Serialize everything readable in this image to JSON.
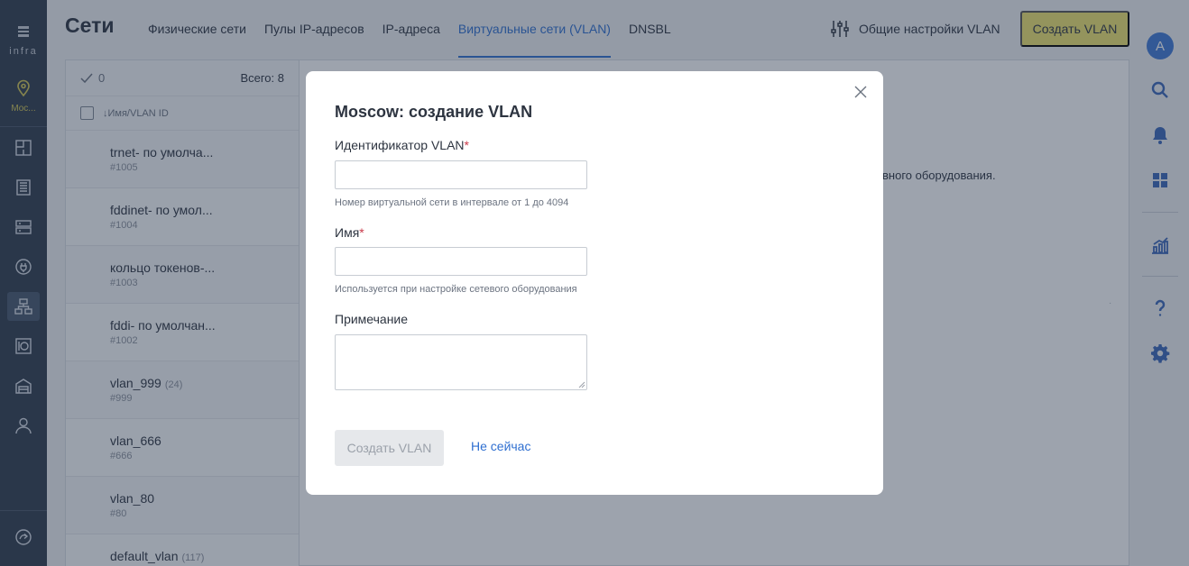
{
  "app": {
    "logo": "infra",
    "location": "Moc..."
  },
  "header": {
    "title": "Сети",
    "tabs": [
      {
        "label": "Физические сети"
      },
      {
        "label": "Пулы IP-адресов"
      },
      {
        "label": "IP-адреса"
      },
      {
        "label": "Виртуальные сети (VLAN)",
        "active": true
      },
      {
        "label": "DNSBL"
      }
    ],
    "settings_label": "Общие настройки VLAN",
    "create_label": "Создать VLAN"
  },
  "list": {
    "selected": "0",
    "total": "Всего: 8",
    "column": "↓Имя/VLAN ID",
    "items": [
      {
        "name": "trnet- по умолча...",
        "count": "",
        "id": "#1005"
      },
      {
        "name": "fddinet- по умол...",
        "count": "",
        "id": "#1004"
      },
      {
        "name": "кольцо токенов-...",
        "count": "",
        "id": "#1003"
      },
      {
        "name": "fddi- по умолчан...",
        "count": "",
        "id": "#1002"
      },
      {
        "name": "vlan_999",
        "count": "(24)",
        "id": "#999"
      },
      {
        "name": "vlan_666",
        "count": "",
        "id": "#666"
      },
      {
        "name": "vlan_80",
        "count": "",
        "id": "#80"
      },
      {
        "name": "default_vlan",
        "count": "(117)",
        "id": ""
      }
    ]
  },
  "background_text": "вного оборудования.",
  "user": {
    "avatar": "A"
  },
  "modal": {
    "title": "Moscow: создание VLAN",
    "vlan_id_label": "Идентификатор VLAN",
    "vlan_id_value": "",
    "vlan_id_hint": "Номер виртуальной сети в интервале от 1 до 4094",
    "name_label": "Имя",
    "name_value": "",
    "name_hint": "Используется при настройке сетевого оборудования",
    "note_label": "Примечание",
    "note_value": "",
    "required_mark": "*",
    "submit_label": "Создать VLAN",
    "cancel_label": "Не сейчас"
  },
  "colors": {
    "accent": "#2f6fd0",
    "create": "#efe36e",
    "nav": "#2f3b4c",
    "required": "#c93a4a"
  }
}
